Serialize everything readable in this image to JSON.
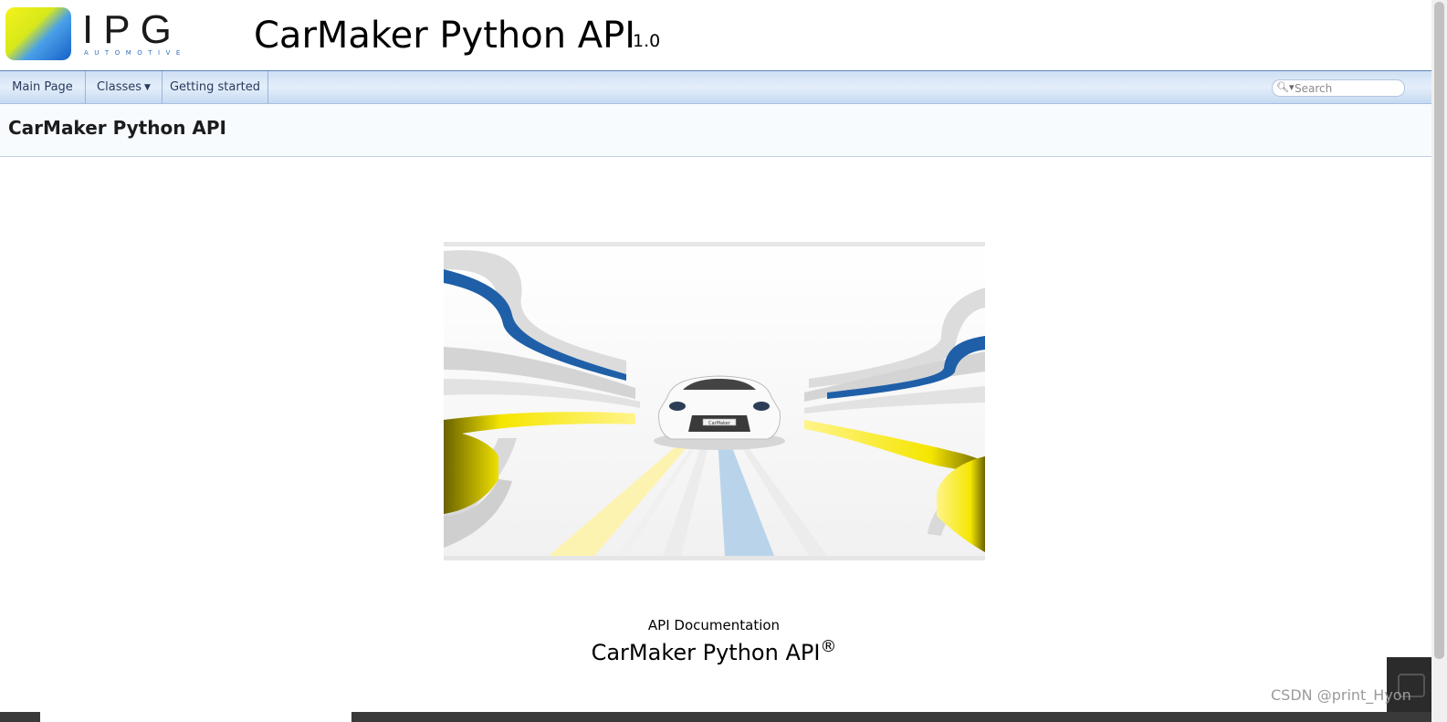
{
  "header": {
    "logo": {
      "text": "IPG",
      "subtext": "AUTOMOTIVE"
    },
    "project_title": "CarMaker Python API",
    "project_version": "1.0"
  },
  "navbar": {
    "items": [
      {
        "label": "Main Page"
      },
      {
        "label": "Classes",
        "has_dropdown": true
      },
      {
        "label": "Getting started"
      }
    ],
    "search": {
      "placeholder": "Search",
      "value": ""
    }
  },
  "page": {
    "title": "CarMaker Python API",
    "hero_badge": "CarMaker",
    "caption_small": "API Documentation",
    "caption_large": "CarMaker Python API",
    "caption_mark": "®"
  },
  "watermark": "CSDN @print_Hyon",
  "colors": {
    "nav_text": "#283a5d",
    "header_border": "#5b82b8",
    "accent_blue": "#1f5fa8",
    "accent_yellow": "#f2e200"
  }
}
